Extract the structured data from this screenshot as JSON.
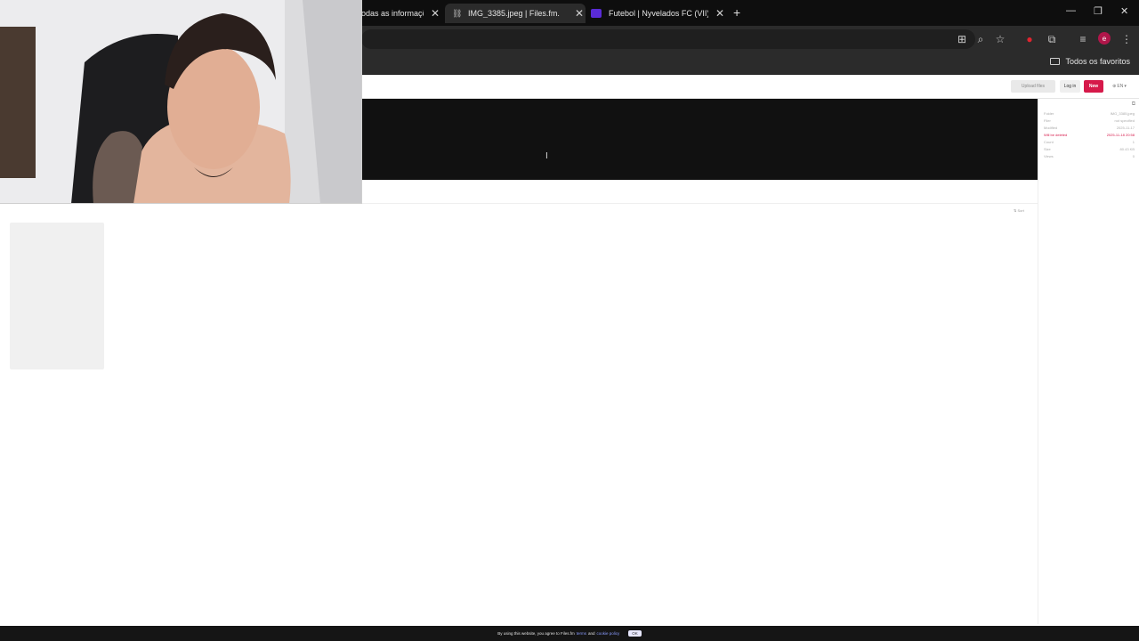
{
  "browser": {
    "tabs": [
      {
        "title": "odas as informaçõe",
        "active": false
      },
      {
        "title": "IMG_3385.jpeg | Files.fm.",
        "active": true
      },
      {
        "title": "Futebol | Nyvelados FC (VII) | C",
        "active": false
      }
    ],
    "new_tab": "+",
    "window_controls": [
      "—",
      "❐",
      "✕"
    ],
    "bookmarks_folder": "Todos os favoritos",
    "profile_initial": "e"
  },
  "site": {
    "upload_label": "Upload files",
    "login_label": "Log in",
    "new_label": "New",
    "lang_label": "EN",
    "sort_label": "Sort",
    "sidepanel": [
      {
        "label": "Folder",
        "value": "IMG_3385.jpeg",
        "warn": false
      },
      {
        "label": "Filer",
        "value": "not specified",
        "warn": false
      },
      {
        "label": "Modified",
        "value": "2025-11-17",
        "warn": false
      },
      {
        "label": "Will be deleted",
        "value": "2025-11-18 20:58",
        "warn": true
      },
      {
        "label": "Count",
        "value": "1",
        "warn": false
      },
      {
        "label": "Size",
        "value": "80.43 KB",
        "warn": false
      },
      {
        "label": "Views",
        "value": "0",
        "warn": false
      }
    ],
    "cookie": {
      "text": "By using this website, you agree to Files.fm",
      "terms": "terms",
      "and": "and",
      "policy": "cookie policy",
      "ok": "OK"
    }
  },
  "colors": {
    "accent": "#d6194a",
    "preview_bg": "#111111"
  }
}
